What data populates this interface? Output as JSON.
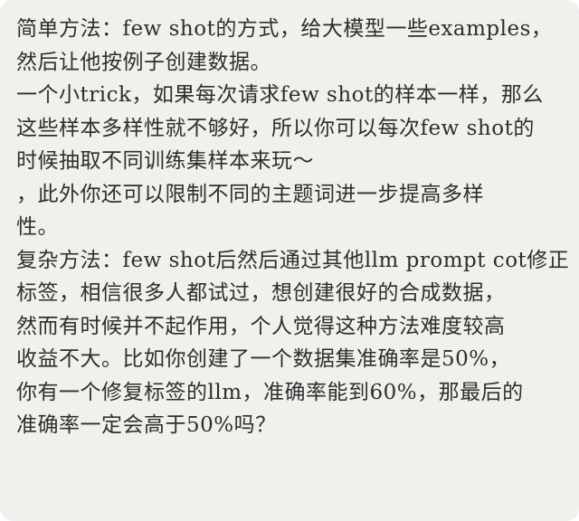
{
  "lines": [
    "简单方法：few shot的方式，给大模型一些examples，",
    "然后让他按例子创建数据。",
    "一个小trick，如果每次请求few shot的样本一样，那么",
    "这些样本多样性就不够好，所以你可以每次few shot的",
    "时候抽取不同训练集样本来玩～",
    "，此外你还可以限制不同的主题词进一步提高多样",
    "性。",
    "复杂方法：few shot后然后通过其他llm prompt cot修正",
    "标签，相信很多人都试过，想创建很好的合成数据，",
    "然而有时候并不起作用，个人觉得这种方法难度较高",
    "收益不大。比如你创建了一个数据集准确率是50%，",
    "你有一个修复标签的llm，准确率能到60%，那最后的",
    "准确率一定会高于50%吗？"
  ]
}
